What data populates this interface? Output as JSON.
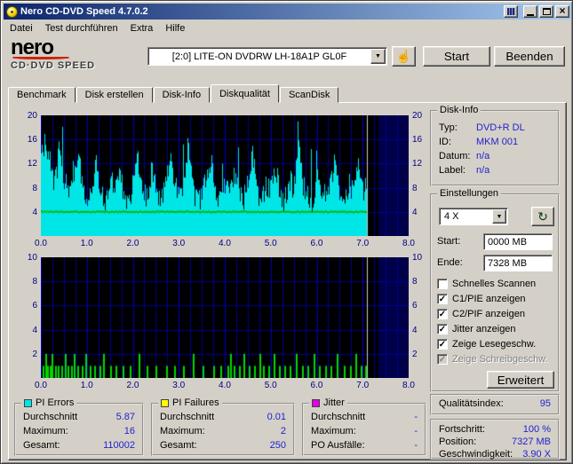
{
  "window": {
    "title": "Nero CD-DVD Speed 4.7.0.2"
  },
  "icons": {
    "dropdown": "▼",
    "refresh": "↻",
    "hand": "☝",
    "check": "✓",
    "close": "×"
  },
  "menu": {
    "items": [
      "Datei",
      "Test durchführen",
      "Extra",
      "Hilfe"
    ]
  },
  "header": {
    "logo_line1": "nero",
    "logo_line2": "CD·DVD SPEED",
    "drive": "[2:0]  LITE-ON DVDRW LH-18A1P GL0F",
    "start_button": "Start",
    "exit_button": "Beenden"
  },
  "tabs": {
    "items": [
      "Benchmark",
      "Disk erstellen",
      "Disk-Info",
      "Diskqualität",
      "ScanDisk"
    ],
    "active": "Diskqualität"
  },
  "disk_info": {
    "title": "Disk-Info",
    "rows": [
      {
        "label": "Typ:",
        "value": "DVD+R DL"
      },
      {
        "label": "ID:",
        "value": "MKM 001"
      },
      {
        "label": "Datum:",
        "value": "n/a"
      },
      {
        "label": "Label:",
        "value": "n/a"
      }
    ]
  },
  "settings": {
    "title": "Einstellungen",
    "speed": "4 X",
    "start_label": "Start:",
    "start_value": "0000 MB",
    "end_label": "Ende:",
    "end_value": "7328 MB",
    "advanced_button": "Erweitert",
    "checkboxes": [
      {
        "label": "Schnelles Scannen",
        "checked": false,
        "disabled": false
      },
      {
        "label": "C1/PIE anzeigen",
        "checked": true,
        "disabled": false
      },
      {
        "label": "C2/PIF anzeigen",
        "checked": true,
        "disabled": false
      },
      {
        "label": "Jitter anzeigen",
        "checked": true,
        "disabled": false
      },
      {
        "label": "Zeige Lesegeschw.",
        "checked": true,
        "disabled": false
      },
      {
        "label": "Zeige Schreibgeschw.",
        "checked": true,
        "disabled": true
      }
    ]
  },
  "quality": {
    "label": "Qualitätsindex:",
    "value": "95"
  },
  "progress": {
    "rows": [
      {
        "label": "Fortschritt:",
        "value": "100 %"
      },
      {
        "label": "Position:",
        "value": "7327 MB"
      },
      {
        "label": "Geschwindigkeit:",
        "value": "3.90 X"
      }
    ]
  },
  "stats": [
    {
      "title": "PI Errors",
      "color": "#00e6e6",
      "rows": [
        {
          "label": "Durchschnitt",
          "value": "5.87"
        },
        {
          "label": "Maximum:",
          "value": "16"
        },
        {
          "label": "Gesamt:",
          "value": "110002"
        }
      ]
    },
    {
      "title": "PI Failures",
      "color": "#ffff00",
      "rows": [
        {
          "label": "Durchschnitt",
          "value": "0.01"
        },
        {
          "label": "Maximum:",
          "value": "2"
        },
        {
          "label": "Gesamt:",
          "value": "250"
        }
      ]
    },
    {
      "title": "Jitter",
      "color": "#e000e0",
      "rows": [
        {
          "label": "Durchschnitt",
          "value": "-"
        },
        {
          "label": "Maximum:",
          "value": "-"
        },
        {
          "label": "PO Ausfälle:",
          "value": "-"
        }
      ]
    }
  ],
  "chart_data": [
    {
      "type": "area",
      "name": "C1/PIE (PI Errors)",
      "xlim": [
        0,
        8
      ],
      "ylim": [
        0,
        20
      ],
      "xticks": [
        "0.0",
        "1.0",
        "2.0",
        "3.0",
        "4.0",
        "5.0",
        "6.0",
        "7.0",
        "8.0"
      ],
      "yticks": [
        "20",
        "16",
        "12",
        "8",
        "4"
      ],
      "grid": true,
      "scan_end": 7.1,
      "sample_step": 0.1,
      "values": [
        12,
        16,
        9,
        8,
        14,
        9,
        6,
        9,
        14,
        7,
        5,
        8,
        12,
        6,
        5,
        9,
        7,
        11,
        6,
        5,
        8,
        13,
        7,
        6,
        10,
        8,
        5,
        7,
        12,
        9,
        6,
        8,
        15,
        7,
        5,
        6,
        9,
        12,
        7,
        5,
        8,
        6,
        10,
        7,
        5,
        9,
        13,
        6,
        5,
        8,
        7,
        11,
        6,
        5,
        9,
        7,
        16,
        8,
        6,
        5,
        10,
        7,
        6,
        9,
        12,
        7,
        5,
        8,
        6,
        11,
        7,
        9
      ],
      "series_color": "#00e6e6",
      "read_speed_value": 4.15,
      "read_speed_color": "#00b400",
      "bg": "#000000",
      "grid_color": "#000090",
      "grid_major_color": "#0000c8",
      "after_end_color": "#000048",
      "end_marker_color": "#c8c8c8",
      "noise_seed": 7,
      "noise_amp": 4
    },
    {
      "type": "bar",
      "name": "C2/PIF (PI Failures)",
      "xlim": [
        0,
        8
      ],
      "ylim": [
        0,
        10
      ],
      "xticks": [
        "0.0",
        "1.0",
        "2.0",
        "3.0",
        "4.0",
        "5.0",
        "6.0",
        "7.0",
        "8.0"
      ],
      "yticks": [
        "10",
        "8",
        "6",
        "4",
        "2"
      ],
      "grid": true,
      "scan_end": 7.1,
      "spikes": [
        [
          0.04,
          1
        ],
        [
          0.09,
          2
        ],
        [
          0.13,
          1
        ],
        [
          0.19,
          1
        ],
        [
          0.24,
          2
        ],
        [
          0.31,
          1
        ],
        [
          0.36,
          1
        ],
        [
          0.44,
          1
        ],
        [
          0.52,
          2
        ],
        [
          0.58,
          1
        ],
        [
          0.66,
          1
        ],
        [
          0.71,
          2
        ],
        [
          0.79,
          1
        ],
        [
          0.88,
          1
        ],
        [
          0.97,
          2
        ],
        [
          1.06,
          1
        ],
        [
          1.15,
          1
        ],
        [
          1.27,
          1
        ],
        [
          1.36,
          2
        ],
        [
          1.5,
          1
        ],
        [
          1.62,
          1
        ],
        [
          1.78,
          1
        ],
        [
          1.94,
          1
        ],
        [
          2.12,
          2
        ],
        [
          2.3,
          1
        ],
        [
          2.5,
          1
        ],
        [
          2.72,
          1
        ],
        [
          2.9,
          1
        ],
        [
          3.1,
          1
        ],
        [
          3.3,
          2
        ],
        [
          3.52,
          1
        ],
        [
          3.74,
          1
        ],
        [
          3.9,
          1
        ],
        [
          4.05,
          1
        ],
        [
          4.12,
          2
        ],
        [
          4.2,
          1
        ],
        [
          4.31,
          1
        ],
        [
          4.4,
          2
        ],
        [
          4.52,
          1
        ],
        [
          4.63,
          1
        ],
        [
          4.75,
          2
        ],
        [
          4.84,
          1
        ],
        [
          4.95,
          1
        ],
        [
          5.07,
          2
        ],
        [
          5.18,
          1
        ],
        [
          5.3,
          1
        ],
        [
          5.42,
          1
        ],
        [
          5.55,
          2
        ],
        [
          5.68,
          1
        ],
        [
          5.8,
          1
        ],
        [
          5.93,
          2
        ],
        [
          6.05,
          1
        ],
        [
          6.18,
          1
        ],
        [
          6.3,
          1
        ],
        [
          6.44,
          2
        ],
        [
          6.58,
          1
        ],
        [
          6.72,
          1
        ],
        [
          6.85,
          2
        ],
        [
          6.95,
          1
        ],
        [
          7.05,
          1
        ]
      ],
      "series_color": "#00d800",
      "bg": "#000000",
      "grid_color": "#000090",
      "grid_major_color": "#0000c8",
      "after_end_color": "#000048",
      "end_marker_color": "#c8c8c8"
    }
  ]
}
